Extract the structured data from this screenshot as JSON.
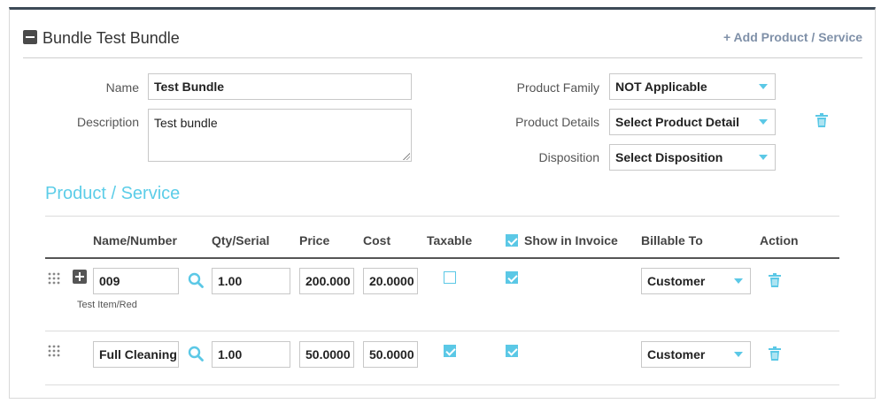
{
  "bundle": {
    "title": "Bundle Test Bundle",
    "add_link": "+ Add Product / Service"
  },
  "form": {
    "name_label": "Name",
    "name_value": "Test Bundle",
    "description_label": "Description",
    "description_value": "Test bundle",
    "family_label": "Product Family",
    "family_value": "NOT Applicable",
    "details_label": "Product Details",
    "details_value": "Select Product Detail",
    "disposition_label": "Disposition",
    "disposition_value": "Select Disposition"
  },
  "section": {
    "title": "Product / Service"
  },
  "columns": {
    "name": "Name/Number",
    "qty": "Qty/Serial",
    "price": "Price",
    "cost": "Cost",
    "taxable": "Taxable",
    "show_invoice": "Show in Invoice",
    "billable": "Billable To",
    "action": "Action"
  },
  "header_show_invoice_checked": true,
  "rows": [
    {
      "name": "009",
      "subtext": "Test Item/Red",
      "qty": "1.00",
      "price": "200.000",
      "cost": "20.0000",
      "taxable": false,
      "show_invoice": true,
      "billable": "Customer"
    },
    {
      "name": "Full Cleaning",
      "subtext": "",
      "qty": "1.00",
      "price": "50.0000",
      "cost": "50.0000",
      "taxable": true,
      "show_invoice": true,
      "billable": "Customer"
    }
  ],
  "colors": {
    "accent": "#5bc8e6",
    "link": "#7f90a8",
    "header_bar": "#3d4a57"
  },
  "icons": {
    "collapse": "minus-square-icon",
    "delete": "trash-icon",
    "search": "search-icon",
    "drag": "drag-handle-icon",
    "expand": "plus-square-icon"
  }
}
